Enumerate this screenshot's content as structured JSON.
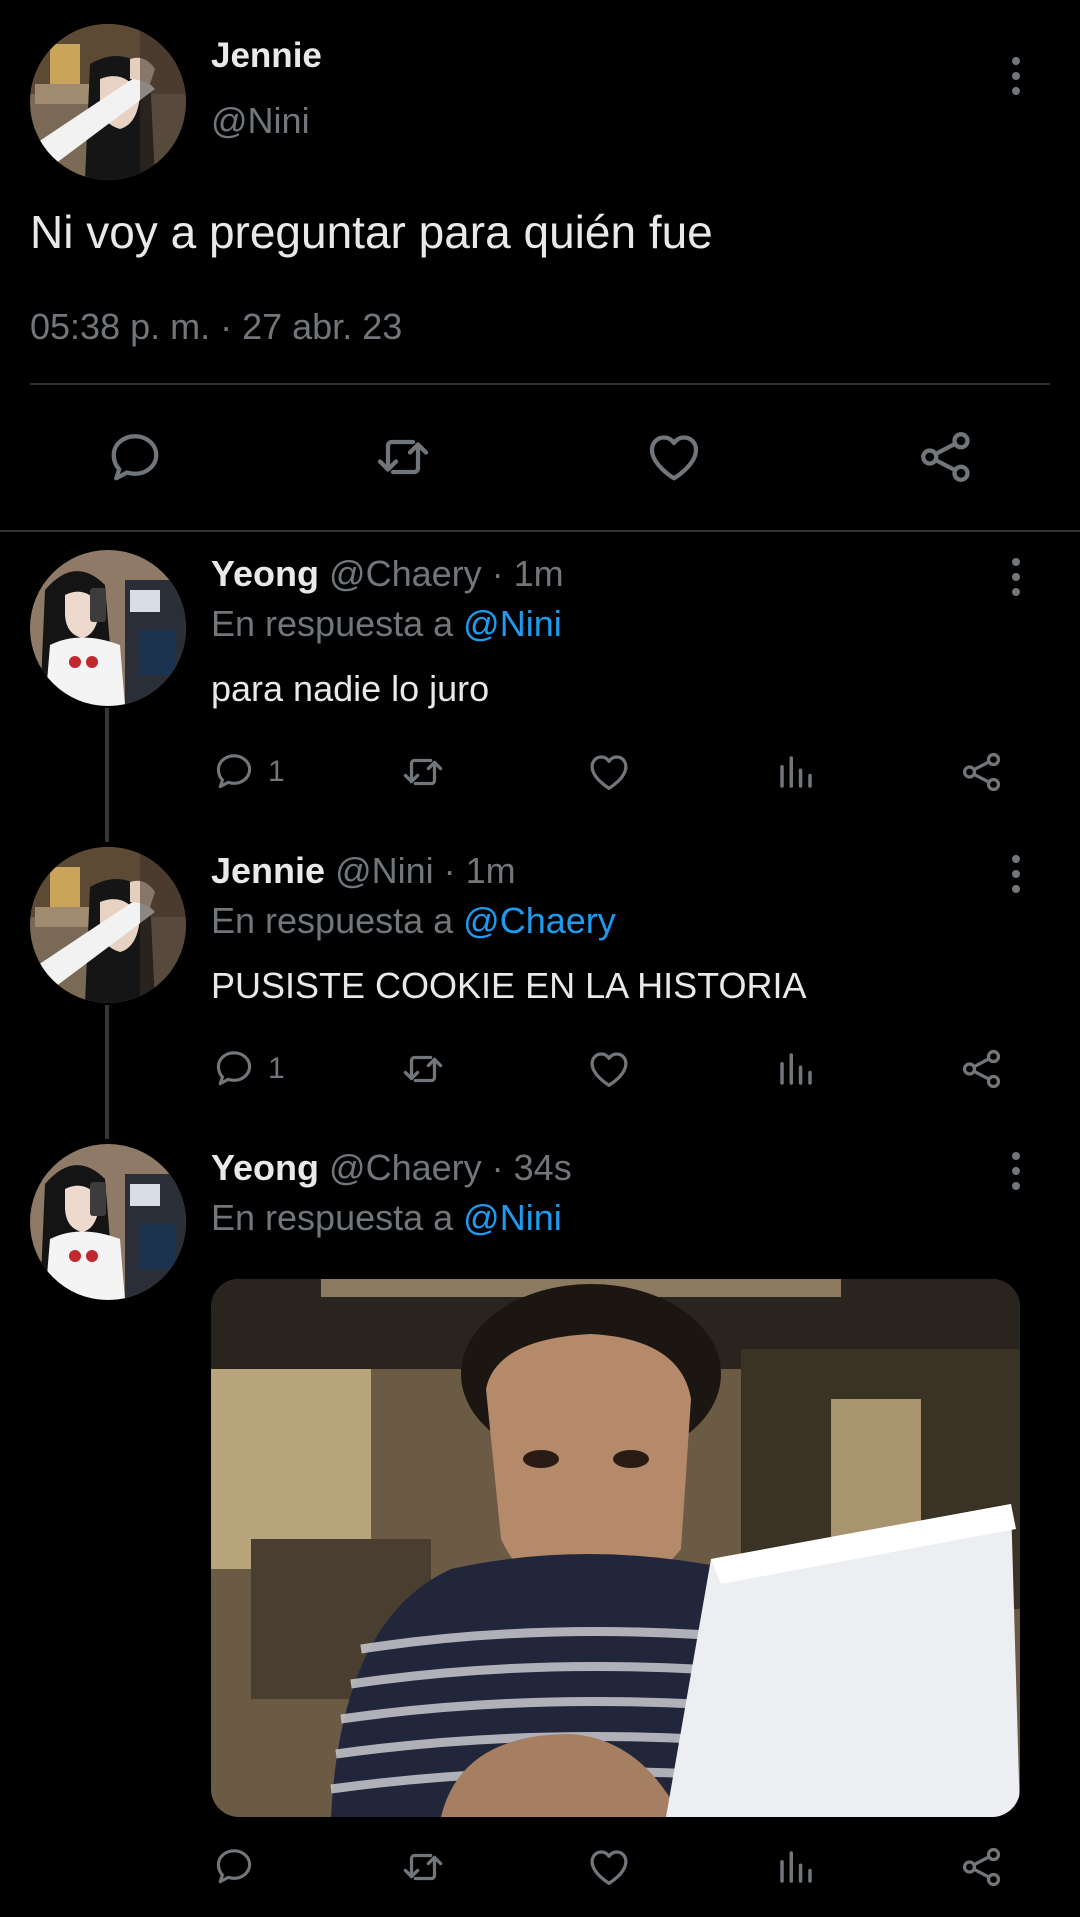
{
  "main_tweet": {
    "author_name": "Jennie",
    "handle": "@Nini",
    "text": "Ni voy a preguntar para quién fue",
    "timestamp": "05:38 p. m. · 27 abr. 23",
    "actions": [
      "reply-icon",
      "retweet-icon",
      "like-icon",
      "share-icon"
    ]
  },
  "replies": [
    {
      "author_name": "Yeong",
      "handle": "@Chaery",
      "time": "· 1m",
      "reply_prefix": "En respuesta a ",
      "reply_to": "@Nini",
      "text": "para nadie lo juro",
      "reply_count": "1"
    },
    {
      "author_name": "Jennie",
      "handle": "@Nini",
      "time": "· 1m",
      "reply_prefix": "En respuesta a ",
      "reply_to": "@Chaery",
      "text": "PUSISTE COOKIE EN LA HISTORIA",
      "reply_count": "1"
    },
    {
      "author_name": "Yeong",
      "handle": "@Chaery",
      "time": "· 34s",
      "reply_prefix": "En respuesta a ",
      "reply_to": "@Nini",
      "media": "reply-photo"
    }
  ],
  "colors": {
    "background": "#000000",
    "text": "#e7e9ea",
    "secondary": "#71767b",
    "link": "#1d9bf0",
    "divider": "#2f3336"
  }
}
